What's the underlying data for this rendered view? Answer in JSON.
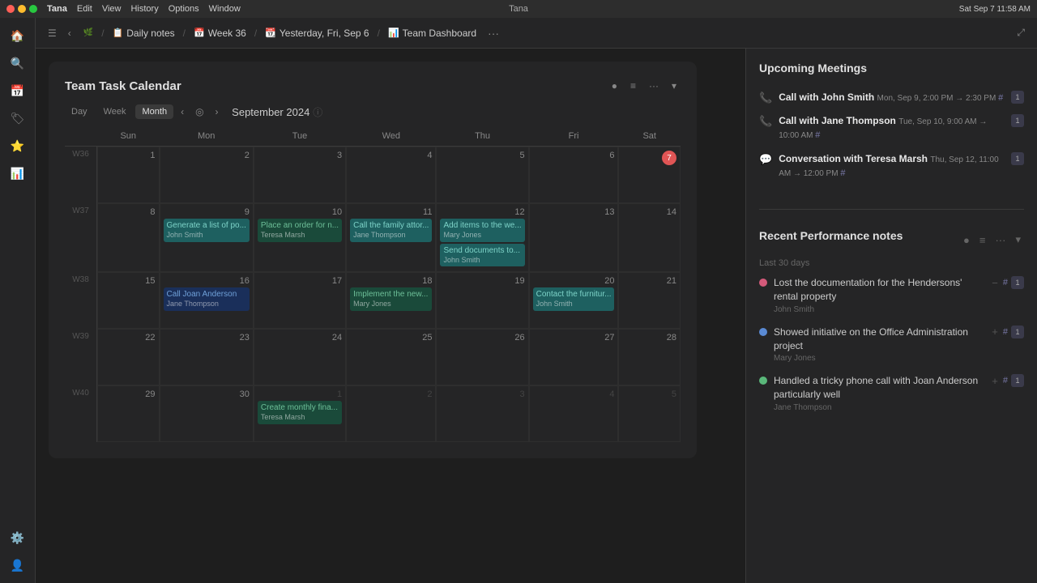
{
  "macbar": {
    "app": "Tana",
    "menu": [
      "Tana",
      "Edit",
      "View",
      "History",
      "Options",
      "Window"
    ],
    "time": "Sat Sep 7  11:58 AM"
  },
  "toolbar": {
    "back": "‹",
    "forward": "›",
    "breadcrumbs": [
      {
        "icon": "📋",
        "label": "Daily notes"
      },
      {
        "icon": "",
        "label": ""
      },
      {
        "icon": "📅",
        "label": "Week 36"
      },
      {
        "icon": "",
        "label": ""
      },
      {
        "icon": "📆",
        "label": "Yesterday, Fri, Sep 6"
      },
      {
        "icon": "",
        "label": ""
      },
      {
        "icon": "📊",
        "label": "Team Dashboard"
      }
    ],
    "more": "···",
    "expand": "⤢"
  },
  "calendar": {
    "title": "Team Task Calendar",
    "month_year": "September 2024",
    "views": [
      "Day",
      "Week",
      "Month"
    ],
    "active_view": "Month",
    "col_headers": [
      "Sun",
      "Mon",
      "Tue",
      "Wed",
      "Thu",
      "Fri",
      "Sat"
    ],
    "weeks": [
      {
        "label": "W36",
        "days": [
          {
            "num": "1",
            "type": "current",
            "events": []
          },
          {
            "num": "2",
            "type": "current",
            "events": []
          },
          {
            "num": "3",
            "type": "current",
            "events": []
          },
          {
            "num": "4",
            "type": "current",
            "events": []
          },
          {
            "num": "5",
            "type": "current",
            "events": []
          },
          {
            "num": "6",
            "type": "current",
            "events": []
          },
          {
            "num": "7",
            "type": "today",
            "events": []
          }
        ]
      },
      {
        "label": "W37",
        "days": [
          {
            "num": "8",
            "type": "current",
            "events": []
          },
          {
            "num": "9",
            "type": "current",
            "events": [
              {
                "title": "Generate a list of po...",
                "person": "John Smith",
                "color": "teal"
              }
            ]
          },
          {
            "num": "10",
            "type": "current",
            "events": [
              {
                "title": "Place an order for n...",
                "person": "Teresa Marsh",
                "color": "green"
              }
            ]
          },
          {
            "num": "11",
            "type": "current",
            "events": [
              {
                "title": "Call the family attor...",
                "person": "Jane Thompson",
                "color": "teal"
              }
            ]
          },
          {
            "num": "12",
            "type": "current",
            "events": [
              {
                "title": "Add items to the we...",
                "person": "Mary Jones",
                "color": "teal"
              },
              {
                "title": "Send documents to...",
                "person": "John Smith",
                "color": "teal"
              }
            ]
          },
          {
            "num": "13",
            "type": "current",
            "events": []
          },
          {
            "num": "14",
            "type": "current",
            "events": []
          }
        ]
      },
      {
        "label": "W38",
        "days": [
          {
            "num": "15",
            "type": "current",
            "events": []
          },
          {
            "num": "16",
            "type": "current",
            "events": [
              {
                "title": "Call Joan Anderson",
                "person": "Jane Thompson",
                "color": "blue"
              }
            ]
          },
          {
            "num": "17",
            "type": "current",
            "events": []
          },
          {
            "num": "18",
            "type": "current",
            "events": [
              {
                "title": "Implement the new...",
                "person": "Mary Jones",
                "color": "green"
              }
            ]
          },
          {
            "num": "19",
            "type": "current",
            "events": []
          },
          {
            "num": "20",
            "type": "current",
            "events": [
              {
                "title": "Contact the furnitur...",
                "person": "John Smith",
                "color": "teal"
              }
            ]
          },
          {
            "num": "21",
            "type": "current",
            "events": []
          }
        ]
      },
      {
        "label": "W39",
        "days": [
          {
            "num": "22",
            "type": "current",
            "events": []
          },
          {
            "num": "23",
            "type": "current",
            "events": []
          },
          {
            "num": "24",
            "type": "current",
            "events": []
          },
          {
            "num": "25",
            "type": "current",
            "events": []
          },
          {
            "num": "26",
            "type": "current",
            "events": []
          },
          {
            "num": "27",
            "type": "current",
            "events": []
          },
          {
            "num": "28",
            "type": "current",
            "events": []
          }
        ]
      },
      {
        "label": "W40",
        "days": [
          {
            "num": "29",
            "type": "current",
            "events": []
          },
          {
            "num": "30",
            "type": "current",
            "events": []
          },
          {
            "num": "1",
            "type": "other",
            "events": [
              {
                "title": "Create monthly fina...",
                "person": "Teresa Marsh",
                "color": "green"
              }
            ]
          },
          {
            "num": "2",
            "type": "other",
            "events": []
          },
          {
            "num": "3",
            "type": "other",
            "events": []
          },
          {
            "num": "4",
            "type": "other",
            "events": []
          },
          {
            "num": "5",
            "type": "other",
            "events": []
          }
        ]
      }
    ]
  },
  "upcoming_meetings": {
    "title": "Upcoming Meetings",
    "items": [
      {
        "icon": "📞",
        "title": "Call with John Smith",
        "date": "Mon, Sep 9, 2:00 PM → 2:30 PM",
        "badge": "1",
        "hash": true
      },
      {
        "icon": "📞",
        "title": "Call with Jane Thompson",
        "date": "Tue, Sep 10, 9:00 AM → 10:00 AM",
        "badge": "1",
        "hash": true
      },
      {
        "icon": "💬",
        "title": "Conversation with Teresa Marsh",
        "date": "Thu, Sep 12, 11:00 AM → 12:00 PM",
        "badge": "1",
        "hash": true
      }
    ]
  },
  "performance": {
    "title": "Recent Performance notes",
    "subtitle": "Last 30 days",
    "items": [
      {
        "dot": "pink",
        "text": "Lost the documentation for the Hendersons' rental property",
        "person": "John Smith",
        "badge": "1",
        "action": "minus",
        "hash": true
      },
      {
        "dot": "blue",
        "text": "Showed initiative on the Office Administration project",
        "person": "Mary Jones",
        "badge": "1",
        "action": "plus",
        "hash": true
      },
      {
        "dot": "green",
        "text": "Handled a tricky phone call with Joan Anderson particularly well",
        "person": "Jane Thompson",
        "badge": "1",
        "action": "plus",
        "hash": true
      }
    ]
  }
}
